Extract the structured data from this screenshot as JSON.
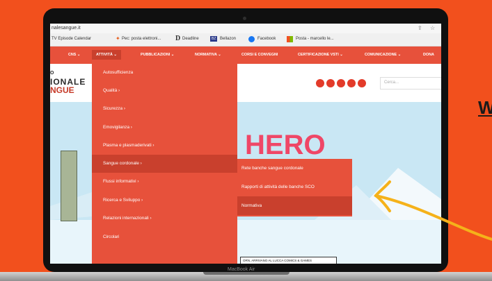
{
  "side_text": "W",
  "device_label": "MacBook Air",
  "browser": {
    "url": "nalesangue.it",
    "bookmarks": [
      {
        "label": "TV Episode Calendar"
      },
      {
        "label": "Pec: posta elettroni..."
      },
      {
        "label": "Deadline"
      },
      {
        "label": "Bellazon"
      },
      {
        "label": "Facebook"
      },
      {
        "label": "Posta - marcello le..."
      }
    ]
  },
  "nav": {
    "items": [
      {
        "label": "CNS ⌄"
      },
      {
        "label": "ATTIVITÀ ⌄"
      },
      {
        "label": "PUBBLICAZIONI ⌄"
      },
      {
        "label": "NORMATIVA ⌄"
      },
      {
        "label": "CORSI E CONVEGNI"
      },
      {
        "label": "CERTIFICAZIONE VSTI ⌄"
      },
      {
        "label": "COMUNICAZIONE ⌄"
      },
      {
        "label": "DONA"
      }
    ]
  },
  "header": {
    "logo_line1": "O",
    "logo_line2": "IONALE",
    "logo_line3": "NGUE",
    "search_placeholder": "Cerca..."
  },
  "menu": {
    "items": [
      {
        "label": "Autosufficienza"
      },
      {
        "label": "Qualità  ›"
      },
      {
        "label": "Sicurezza  ›"
      },
      {
        "label": "Emovigilanza  ›"
      },
      {
        "label": "Plasma e plasmaderivati  ›"
      },
      {
        "label": "Sangue cordonale  ›"
      },
      {
        "label": "Flussi informativi  ›"
      },
      {
        "label": "Ricerca e Sviluppo  ›"
      },
      {
        "label": "Relazioni internazionali  ›"
      },
      {
        "label": "Circolari"
      }
    ],
    "active_index": 5
  },
  "submenu": {
    "items": [
      {
        "label": "Rete banche sangue cordonale"
      },
      {
        "label": "Rapporti di attività delle banche SCO"
      },
      {
        "label": "Normativa"
      }
    ],
    "active_index": 2
  },
  "artwork": {
    "title": "HERO",
    "caption": "ORN, ARRIVANO AL LUCCA COMICS & GAMES"
  },
  "colors": {
    "background": "#f2501d",
    "menu": "#e7513b",
    "menu_active": "#c9402d",
    "arrow": "#f5b21a"
  }
}
